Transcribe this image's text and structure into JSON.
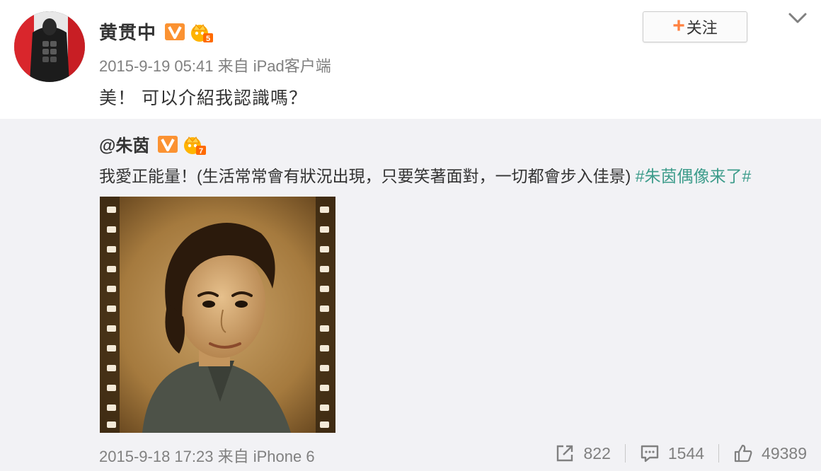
{
  "post": {
    "author": "黄贯中",
    "timestamp": "2015-9-19 05:41",
    "source": "来自 iPad客户端",
    "text": "美！ 可以介紹我認識嗎？",
    "crown_level": "5",
    "follow_plus": "+",
    "follow_label": "关注"
  },
  "repost": {
    "author": "@朱茵",
    "crown_level": "7",
    "text": "我愛正能量！(生活常常會有狀況出現，只要笑著面對，一切都會步入佳景) ",
    "hashtag": "#朱茵偶像来了#",
    "timestamp": "2015-9-18 17:23",
    "source": "来自 iPhone 6",
    "reposts": "822",
    "comments": "1544",
    "likes": "49389"
  },
  "colors": {
    "badge_orange": "#ff8140",
    "hashtag": "#3d9c8b",
    "meta_gray": "#808080",
    "repost_bg": "#f2f2f5"
  },
  "icons": [
    "verified-v-icon",
    "crown-icon",
    "chevron-down-icon",
    "repost-icon",
    "comment-icon",
    "like-icon"
  ]
}
